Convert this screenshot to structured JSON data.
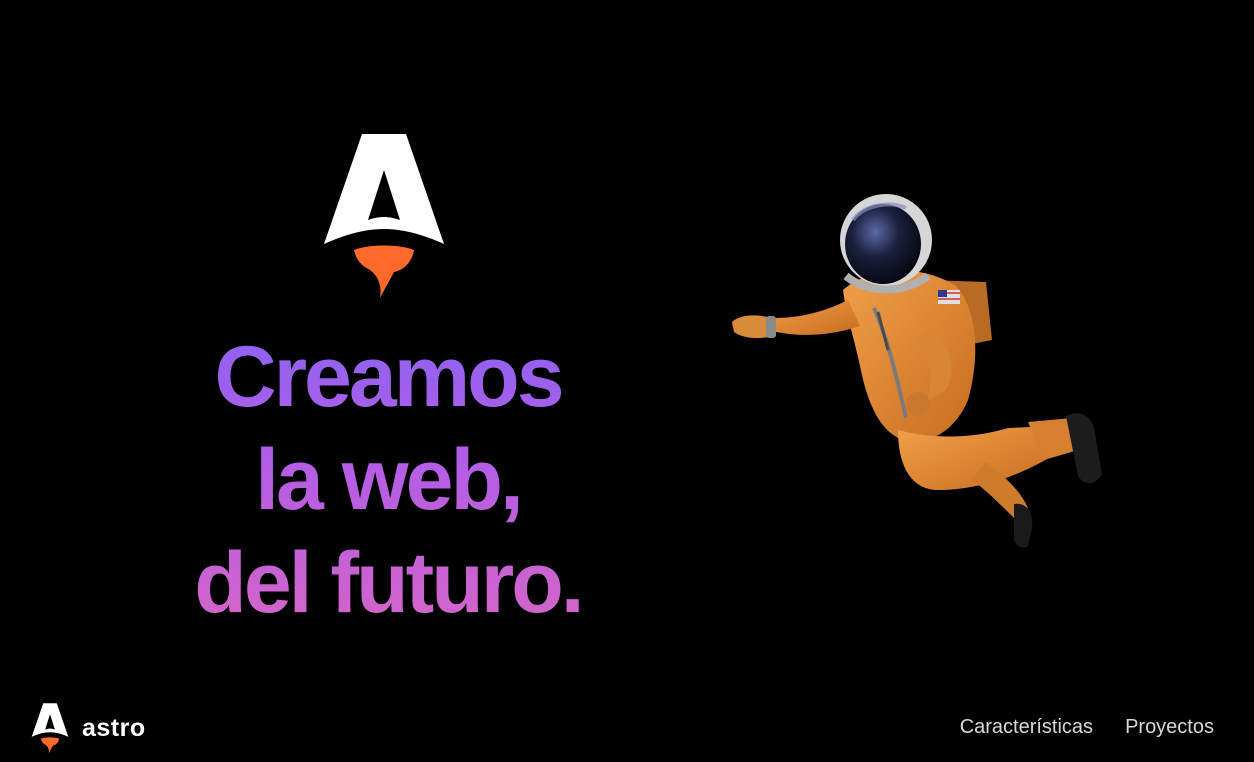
{
  "brand": {
    "name": "astro",
    "colors": {
      "background": "#000000",
      "logo_white": "#ffffff",
      "logo_flame": "#ff6a2a",
      "gradient_start": "#8b63f2",
      "gradient_mid": "#b45de6",
      "gradient_end": "#d565c8"
    }
  },
  "hero": {
    "logo_icon": "astro-rocket-logo-icon",
    "headline_lines": [
      "Creamos",
      "la web,",
      "del futuro."
    ],
    "illustration": "astronaut-illustration"
  },
  "footer": {
    "logo_icon": "astro-rocket-logo-icon",
    "nav": [
      {
        "label": "Características"
      },
      {
        "label": "Proyectos"
      }
    ]
  }
}
